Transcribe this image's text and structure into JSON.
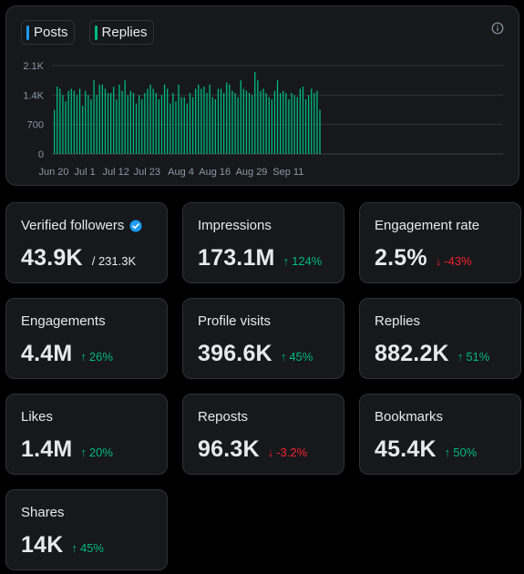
{
  "chart_data": {
    "type": "bar",
    "series": [
      {
        "name": "Posts",
        "color": "#1d9bf0",
        "values": []
      },
      {
        "name": "Replies",
        "color": "#00ba7c",
        "values": [
          1050,
          1600,
          1550,
          1400,
          1250,
          1500,
          1550,
          1500,
          1400,
          1550,
          1150,
          1500,
          1400,
          1300,
          1750,
          1400,
          1650,
          1650,
          1550,
          1450,
          1450,
          1600,
          1300,
          1650,
          1500,
          1750,
          1400,
          1500,
          1450,
          1200,
          1400,
          1300,
          1450,
          1550,
          1650,
          1550,
          1450,
          1300,
          1400,
          1650,
          1550,
          1200,
          1450,
          1250,
          1650,
          1350,
          1350,
          1200,
          1450,
          1350,
          1550,
          1650,
          1550,
          1600,
          1450,
          1650,
          1350,
          1300,
          1550,
          1550,
          1450,
          1700,
          1650,
          1500,
          1450,
          1350,
          1750,
          1550,
          1500,
          1450,
          1400,
          1950,
          1750,
          1500,
          1550,
          1450,
          1350,
          1300,
          1500,
          1750,
          1450,
          1500,
          1450,
          1300,
          1450,
          1400,
          1350,
          1550,
          1600,
          1300,
          1400,
          1550,
          1450,
          1500,
          1050
        ]
      }
    ],
    "x_ticks": [
      "Jun 20",
      "Jul 1",
      "Jul 12",
      "Jul 23",
      "Aug 4",
      "Aug 16",
      "Aug 29",
      "Sep 11"
    ],
    "y_ticks": [
      "0",
      "700",
      "1.4K",
      "2.1K"
    ],
    "y_tick_values": [
      0,
      700,
      1400,
      2100
    ],
    "ylim": [
      0,
      2100
    ],
    "grid": true,
    "title": "",
    "xlabel": "",
    "ylabel": ""
  },
  "legend": {
    "posts_label": "Posts",
    "replies_label": "Replies"
  },
  "cards": [
    {
      "label": "Verified followers",
      "value": "43.9K",
      "sub": "/ 231.3K",
      "verified": true
    },
    {
      "label": "Impressions",
      "value": "173.1M",
      "delta": "124%",
      "direction": "up"
    },
    {
      "label": "Engagement rate",
      "value": "2.5%",
      "delta": "-43%",
      "direction": "down"
    },
    {
      "label": "Engagements",
      "value": "4.4M",
      "delta": "26%",
      "direction": "up"
    },
    {
      "label": "Profile visits",
      "value": "396.6K",
      "delta": "45%",
      "direction": "up"
    },
    {
      "label": "Replies",
      "value": "882.2K",
      "delta": "51%",
      "direction": "up"
    },
    {
      "label": "Likes",
      "value": "1.4M",
      "delta": "20%",
      "direction": "up"
    },
    {
      "label": "Reposts",
      "value": "96.3K",
      "delta": "-3.2%",
      "direction": "down"
    },
    {
      "label": "Bookmarks",
      "value": "45.4K",
      "delta": "50%",
      "direction": "up"
    },
    {
      "label": "Shares",
      "value": "14K",
      "delta": "45%",
      "direction": "up"
    }
  ],
  "colors": {
    "up": "#00ba7c",
    "down": "#f4212e",
    "posts": "#1d9bf0",
    "replies": "#00ba7c",
    "verified": "#1d9bf0"
  }
}
